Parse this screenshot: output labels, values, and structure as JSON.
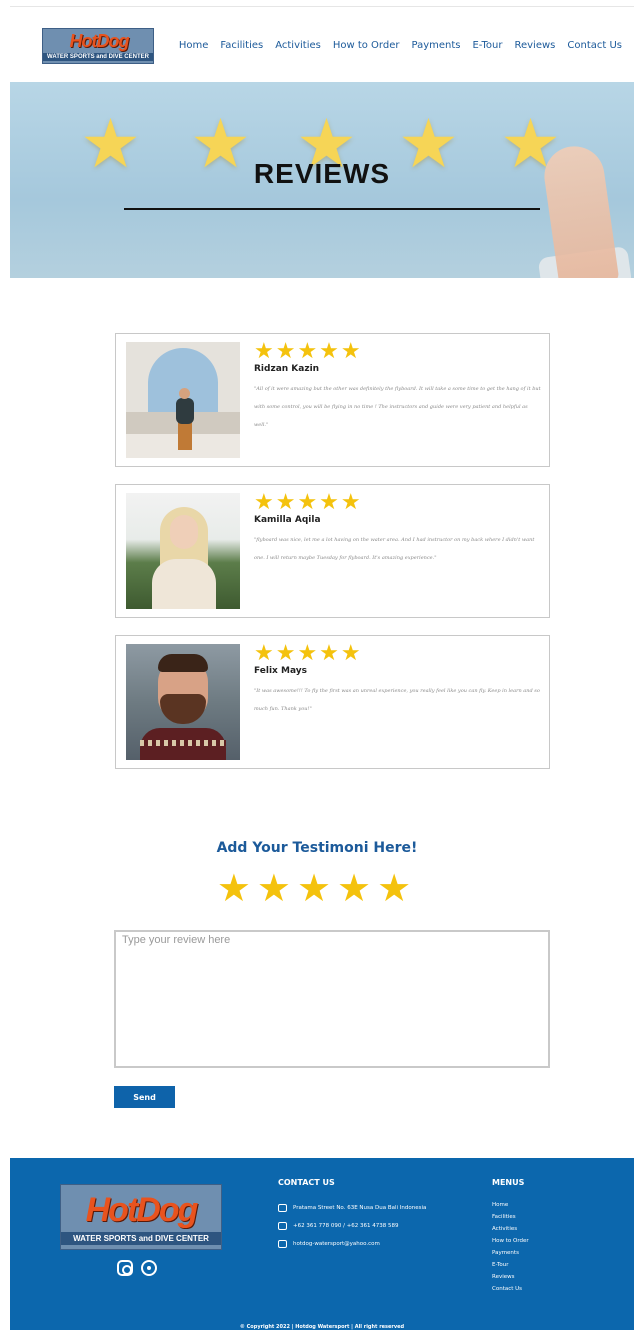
{
  "brand": {
    "logo_word": "HotDog",
    "logo_sub": "WATER SPORTS and DIVE CENTER"
  },
  "nav": [
    "Home",
    "Facilities",
    "Activities",
    "How to Order",
    "Payments",
    "E-Tour",
    "Reviews",
    "Contact Us"
  ],
  "hero": {
    "title": "REVIEWS",
    "star_glyph": "★"
  },
  "reviews": [
    {
      "name": "Ridzan Kazin",
      "rating": 5,
      "stars": "★★★★★",
      "quote": "\"All of it were amazing but the other was definitely the flyboard. It will take a some time to get the hang of it but with some control, you will be flying in no time ! The instructors and guide were very patient and helpful as well.\""
    },
    {
      "name": "Kamilla Aqila",
      "rating": 5,
      "stars": "★★★★★",
      "quote": "\"flyboard was nice, let me a lot having on the water area. And I had instructor on my back where I didn't want one. I will return maybe Tuesday for flyboard. It's amazing experience.\""
    },
    {
      "name": "Felix Mays",
      "rating": 5,
      "stars": "★★★★★",
      "quote": "\"It was awesome!!! To fly the first was an unreal experience, you really feel like you can fly. Keep in learn and so much fun. Thank you!\""
    }
  ],
  "testimonial": {
    "title": "Add Your Testimoni Here!",
    "stars": "★★★★★",
    "placeholder": "Type your review here",
    "send_label": "Send"
  },
  "footer": {
    "logo_word": "HotDog",
    "logo_sub": "WATER SPORTS and DIVE CENTER",
    "contact_title": "CONTACT US",
    "address": "Pratama Street No. 63E Nusa Dua Bali Indonesia",
    "phone": "+62 361 778 090 / +62 361 4738 589",
    "email": "hotdog-watersport@yahoo.com",
    "menu_title": "MENUS",
    "menu": [
      "Home",
      "Facilities",
      "Activities",
      "How to Order",
      "Payments",
      "E-Tour",
      "Reviews",
      "Contact Us"
    ],
    "copyright": "© Copyright 2022 | Hotdog Watersport | All right reserved"
  },
  "colors": {
    "nav_link": "#1c5a9a",
    "accent": "#0c67ad",
    "star": "#f4c20d"
  }
}
